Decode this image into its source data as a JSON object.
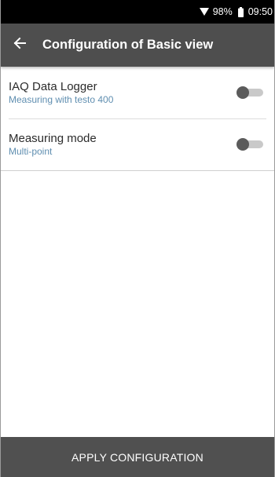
{
  "status_bar": {
    "wifi_icon": "wifi-icon",
    "battery_percent": "98%",
    "battery_icon": "battery-icon",
    "time": "09:50"
  },
  "app_bar": {
    "back_icon": "arrow-back-icon",
    "title": "Configuration of Basic view"
  },
  "settings": [
    {
      "label": "IAQ Data Logger",
      "subtitle": "Measuring with testo 400",
      "enabled": false
    },
    {
      "label": "Measuring mode",
      "subtitle": "Multi-point",
      "enabled": false
    }
  ],
  "apply_button": {
    "label": "APPLY CONFIGURATION"
  },
  "colors": {
    "app_bar": "#4e4e4e",
    "subtitle": "#5f8eb0",
    "toggle_thumb": "#5b5b5b",
    "toggle_track": "#c9c9c9",
    "apply_button": "#505050"
  }
}
